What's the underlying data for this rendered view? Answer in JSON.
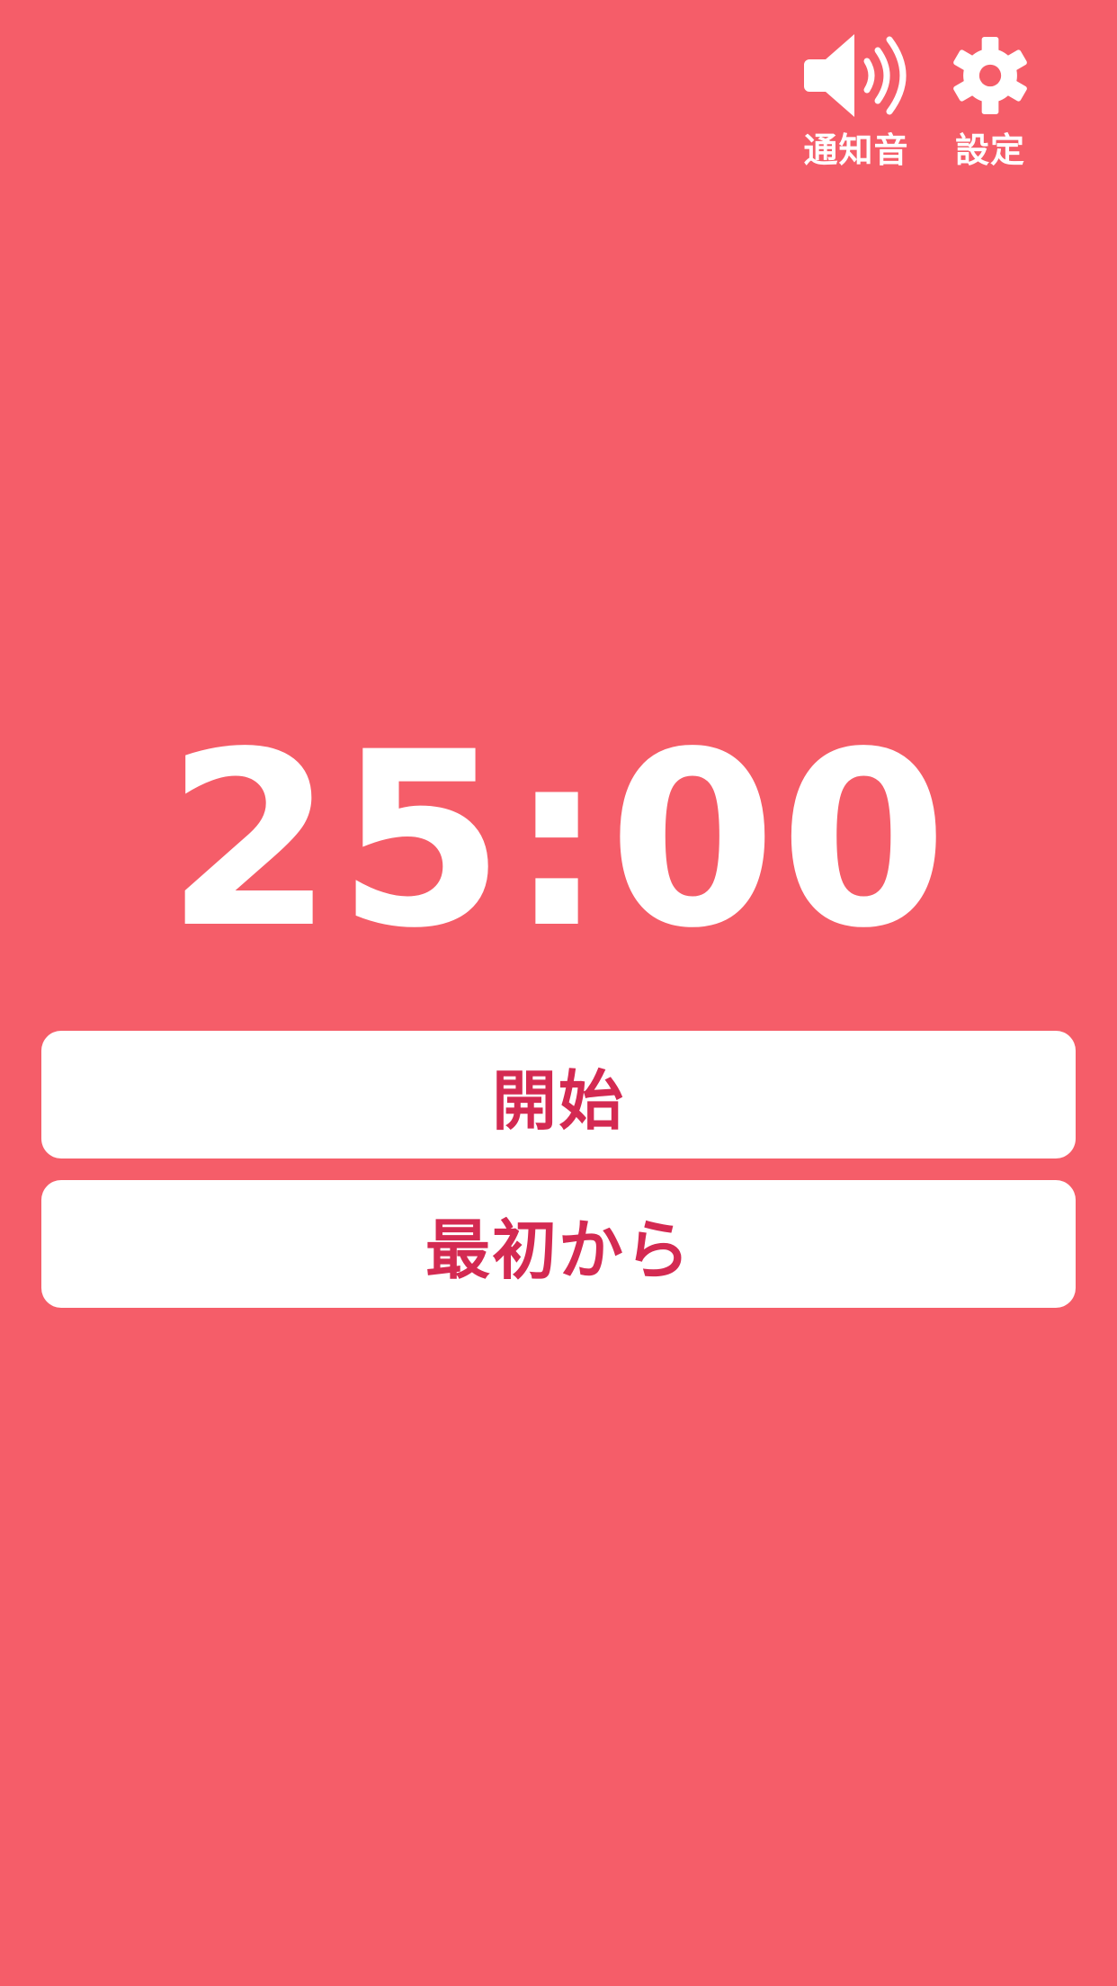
{
  "colors": {
    "background": "#f55d69",
    "icon": "#ffffff",
    "button_bg": "#ffffff",
    "button_text": "#d42a52"
  },
  "header": {
    "sound": {
      "label": "通知音",
      "icon": "speaker-icon"
    },
    "settings": {
      "label": "設定",
      "icon": "gear-icon"
    }
  },
  "timer": {
    "display": "25:00"
  },
  "buttons": {
    "start_label": "開始",
    "reset_label": "最初から"
  }
}
